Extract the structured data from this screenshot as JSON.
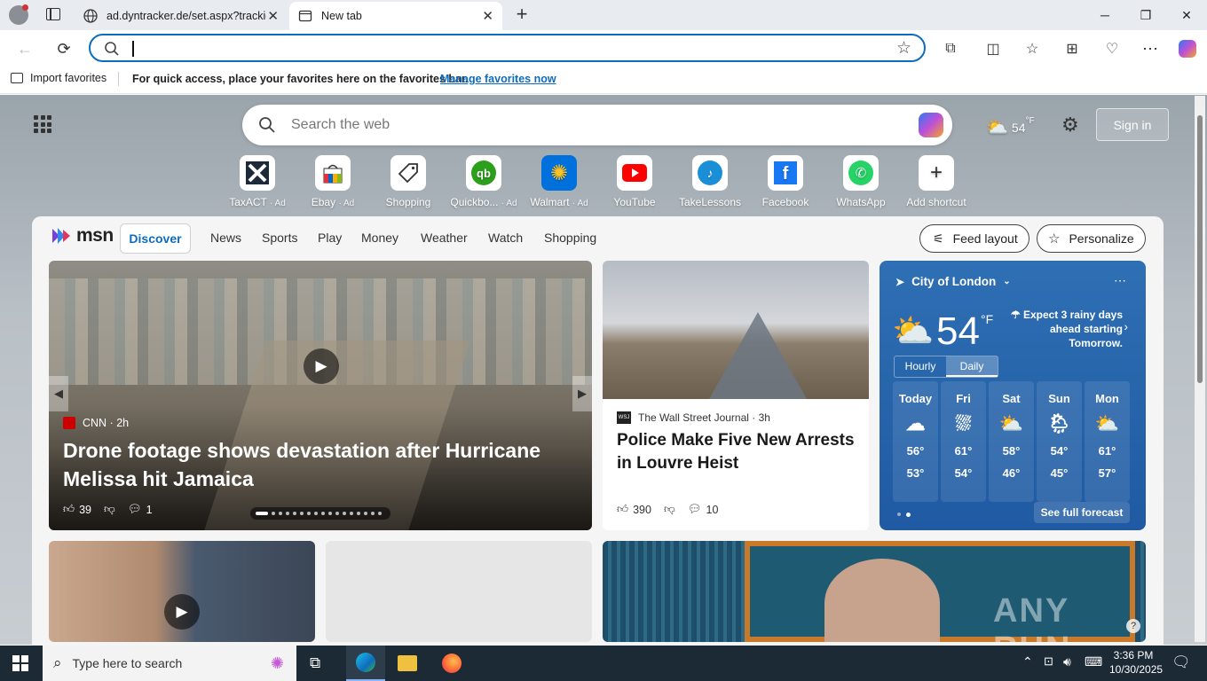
{
  "browser": {
    "tabs": [
      {
        "label": "ad.dyntracker.de/set.aspx?trackid"
      },
      {
        "label": "New tab"
      }
    ],
    "address_placeholder": "",
    "favorites_bar": {
      "import_label": "Import favorites",
      "hint": "For quick access, place your favorites here on the favorites bar.",
      "manage_link": "Manage favorites now"
    }
  },
  "newtab": {
    "search_placeholder": "Search the web",
    "weather_temp": "54",
    "weather_unit": "°F",
    "sign_in": "Sign in",
    "shortcuts": [
      {
        "label": "TaxACT",
        "ad": "· Ad",
        "icon": "taxact-icon"
      },
      {
        "label": "Ebay",
        "ad": "· Ad",
        "icon": "ebay-icon"
      },
      {
        "label": "Shopping",
        "ad": "",
        "icon": "tag-icon"
      },
      {
        "label": "Quickbo...",
        "ad": "· Ad",
        "icon": "quickbooks-icon"
      },
      {
        "label": "Walmart",
        "ad": "· Ad",
        "icon": "walmart-icon"
      },
      {
        "label": "YouTube",
        "ad": "",
        "icon": "youtube-icon"
      },
      {
        "label": "TakeLessons",
        "ad": "",
        "icon": "takelessons-icon"
      },
      {
        "label": "Facebook",
        "ad": "",
        "icon": "facebook-icon"
      },
      {
        "label": "WhatsApp",
        "ad": "",
        "icon": "whatsapp-icon"
      },
      {
        "label": "Add shortcut",
        "ad": "",
        "icon": "plus-icon"
      }
    ]
  },
  "feed": {
    "brand": "msn",
    "nav": [
      "Discover",
      "News",
      "Sports",
      "Play",
      "Money",
      "Weather",
      "Watch",
      "Shopping"
    ],
    "feed_layout": "Feed layout",
    "personalize": "Personalize",
    "hero": {
      "source": "CNN",
      "time": "· 2h",
      "title": "Drone footage shows devastation after Hurricane Melissa hit Jamaica",
      "likes": "39",
      "comments": "1"
    },
    "card2": {
      "source": "The Wall Street Journal",
      "time": "· 3h",
      "title": "Police Make Five New Arrests in Louvre Heist",
      "likes": "390",
      "comments": "10"
    }
  },
  "weather": {
    "location": "City of London",
    "temp": "54",
    "unit": "°F",
    "alert": "Expect 3 rainy days ahead starting Tomorrow.",
    "tabs": [
      "Hourly",
      "Daily"
    ],
    "days": [
      {
        "day": "Today",
        "hi": "56°",
        "lo": "53°",
        "icon": "cloudy-icon"
      },
      {
        "day": "Fri",
        "hi": "61°",
        "lo": "54°",
        "icon": "rain-icon"
      },
      {
        "day": "Sat",
        "hi": "58°",
        "lo": "46°",
        "icon": "partly-sunny-icon"
      },
      {
        "day": "Sun",
        "hi": "54°",
        "lo": "45°",
        "icon": "partly-sunny-rain-icon"
      },
      {
        "day": "Mon",
        "hi": "61°",
        "lo": "57°",
        "icon": "partly-cloudy-icon"
      }
    ],
    "see_full": "See full forecast"
  },
  "taskbar": {
    "search_placeholder": "Type here to search",
    "time": "3:36 PM",
    "date": "10/30/2025"
  },
  "watermark": "ANY RUN"
}
